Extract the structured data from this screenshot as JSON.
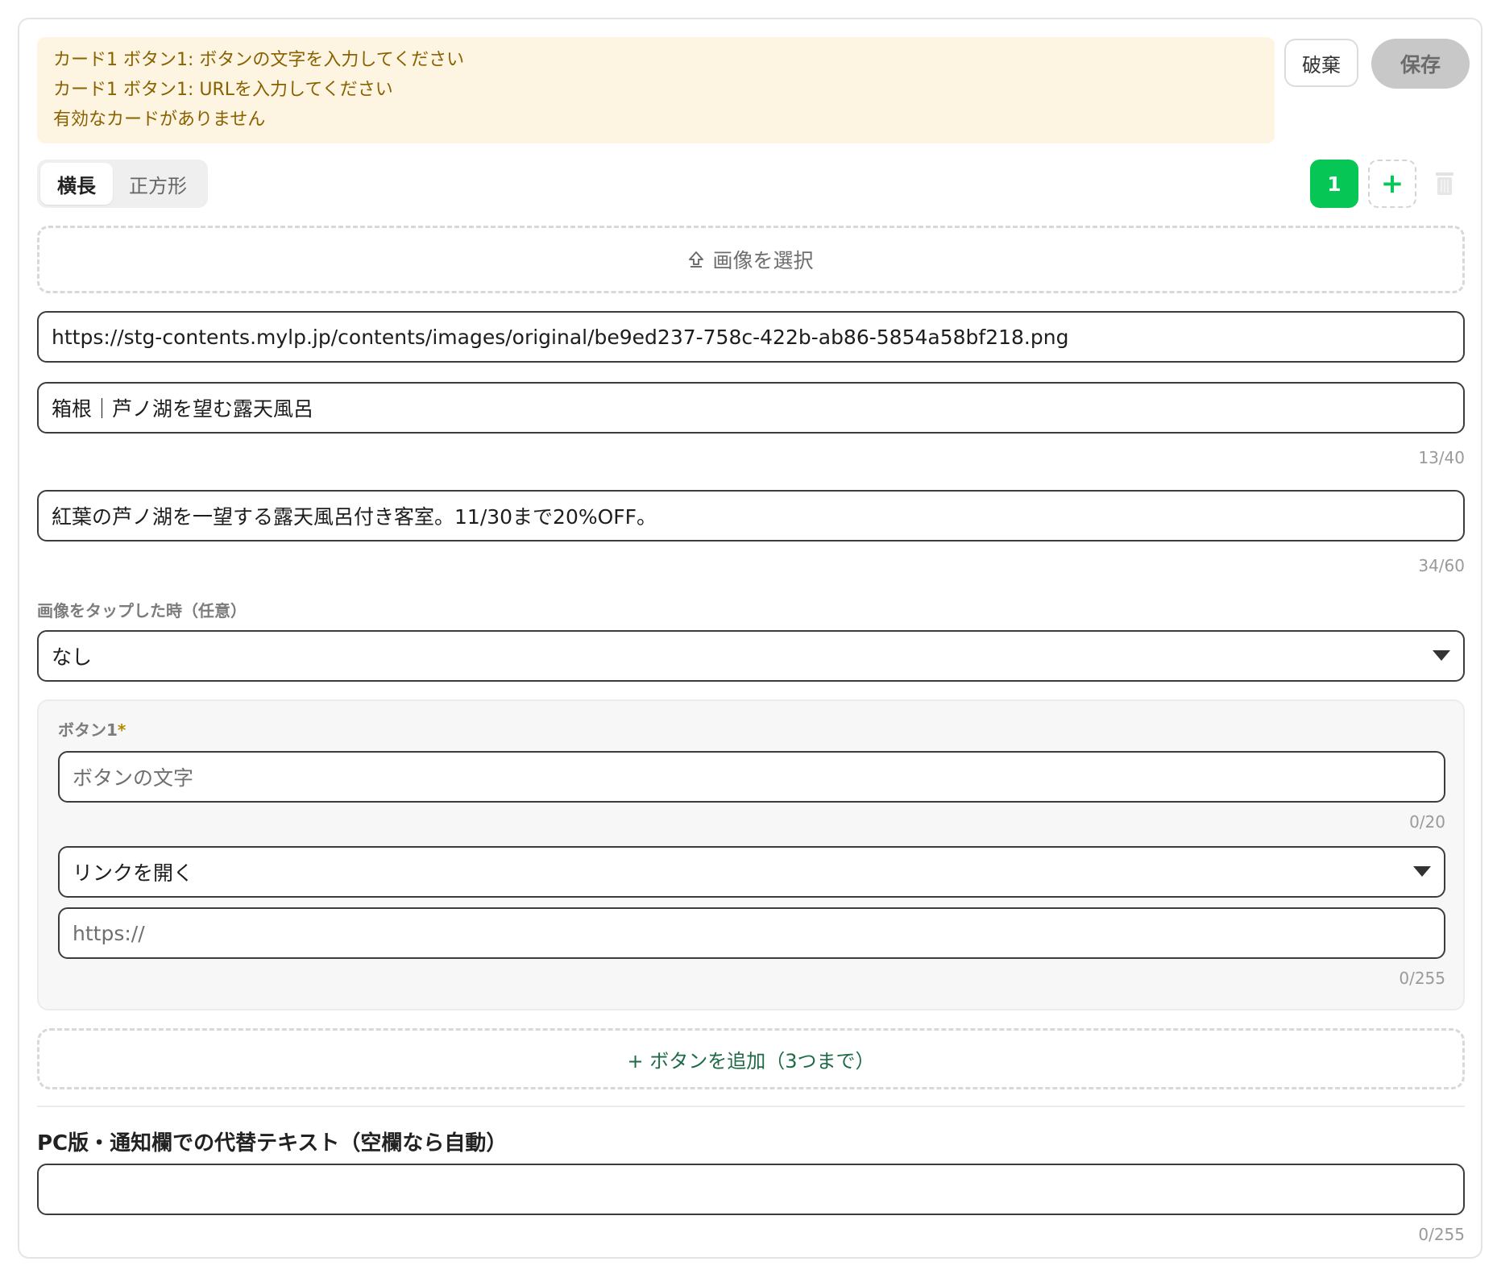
{
  "alert": {
    "messages": [
      "カード1 ボタン1: ボタンの文字を入力してください",
      "カード1 ボタン1: URLを入力してください",
      "有効なカードがありません"
    ]
  },
  "actions": {
    "discard_label": "破棄",
    "save_label": "保存"
  },
  "layout_toggle": {
    "options": [
      "横長",
      "正方形"
    ],
    "selected": "横長"
  },
  "cards": {
    "current_number": "1",
    "add_icon": "plus-icon",
    "delete_icon": "trash-icon"
  },
  "image_upload": {
    "label": "画像を選択",
    "icon": "upload-icon"
  },
  "image_url": {
    "value": "https://stg-contents.mylp.jp/contents/images/original/be9ed237-758c-422b-ab86-5854a58bf218.png"
  },
  "title_field": {
    "value": "箱根｜芦ノ湖を望む露天風呂",
    "counter": "13/40"
  },
  "description_field": {
    "value": "紅葉の芦ノ湖を一望する露天風呂付き客室。11/30まで20%OFF。",
    "counter": "34/60"
  },
  "tap_action": {
    "label": "画像をタップした時（任意）",
    "selected": "なし"
  },
  "button1": {
    "label": "ボタン1",
    "required_mark": "*",
    "text_placeholder": "ボタンの文字",
    "text_counter": "0/20",
    "action_selected": "リンクを開く",
    "url_value": "https://",
    "url_counter": "0/255"
  },
  "add_button": {
    "label": "+ ボタンを追加（3つまで）"
  },
  "alt_text": {
    "title": "PC版・通知欄での代替テキスト（空欄なら自動）",
    "value": "",
    "counter": "0/255"
  },
  "colors": {
    "accent_green": "#06c755",
    "alert_bg": "#fdf5e1",
    "alert_text": "#8a6100",
    "save_disabled_bg": "#c8c8c8"
  }
}
